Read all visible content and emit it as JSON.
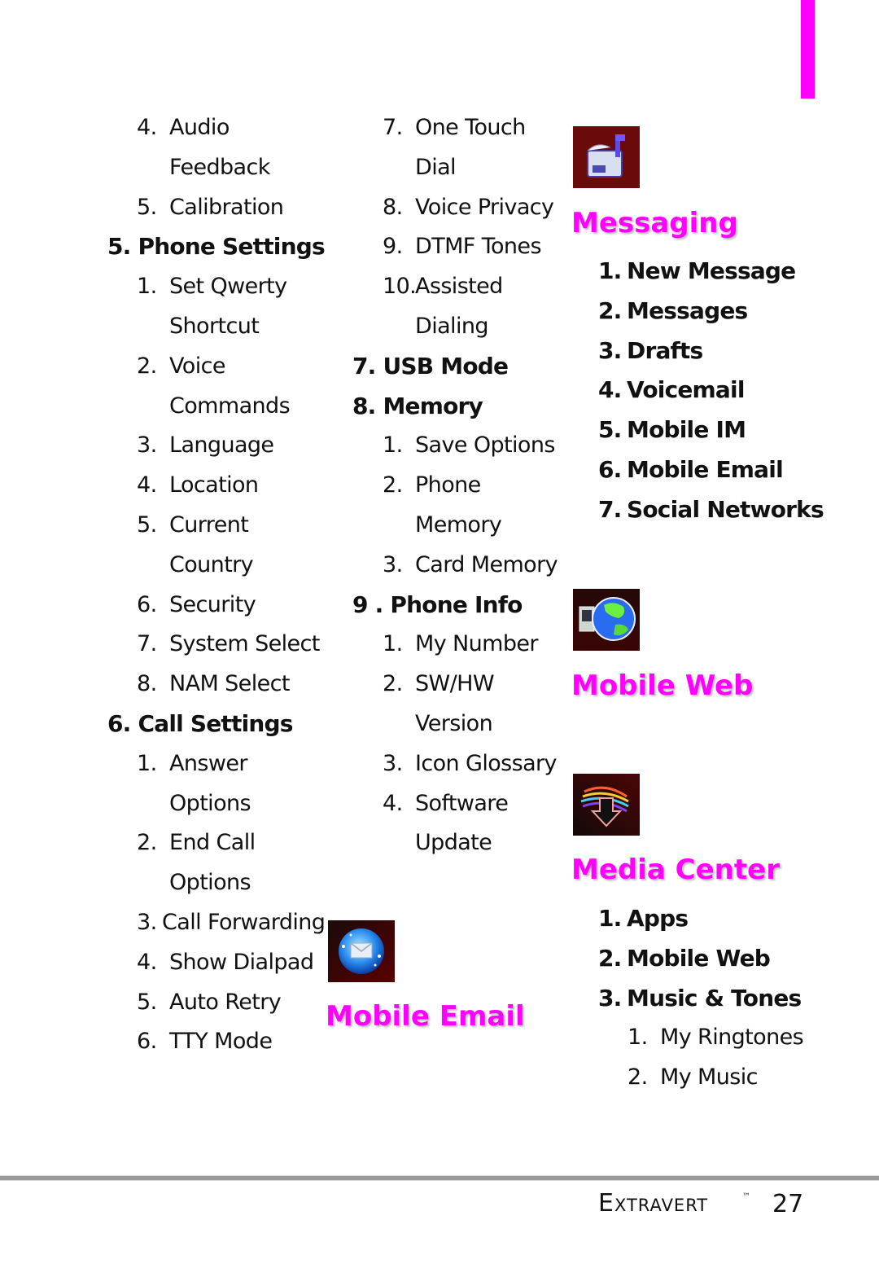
{
  "page": {
    "brand": "Extravert",
    "trademark": "™",
    "page_number": "27",
    "accent_color": "#ff00ff"
  },
  "col1": [
    {
      "type": "sub",
      "num": "4.",
      "text": "Audio"
    },
    {
      "type": "cont",
      "text": "Feedback"
    },
    {
      "type": "sub",
      "num": "5.",
      "text": "Calibration"
    },
    {
      "type": "head",
      "num": "5.",
      "text": "Phone Settings"
    },
    {
      "type": "sub",
      "num": "1.",
      "text": "Set Qwerty"
    },
    {
      "type": "cont",
      "text": "Shortcut"
    },
    {
      "type": "sub",
      "num": "2.",
      "text": "Voice"
    },
    {
      "type": "cont",
      "text": "Commands"
    },
    {
      "type": "sub",
      "num": "3.",
      "text": "Language"
    },
    {
      "type": "sub",
      "num": "4.",
      "text": "Location"
    },
    {
      "type": "sub",
      "num": "5.",
      "text": "Current"
    },
    {
      "type": "cont",
      "text": "Country"
    },
    {
      "type": "sub",
      "num": "6.",
      "text": "Security"
    },
    {
      "type": "sub",
      "num": "7.",
      "text": "System Select"
    },
    {
      "type": "sub",
      "num": "8.",
      "text": "NAM Select"
    },
    {
      "type": "head",
      "num": "6.",
      "text": "Call Settings"
    },
    {
      "type": "sub",
      "num": "1.",
      "text": "Answer"
    },
    {
      "type": "cont",
      "text": "Options"
    },
    {
      "type": "sub",
      "num": "2.",
      "text": "End Call"
    },
    {
      "type": "cont",
      "text": "Options"
    },
    {
      "type": "subtight",
      "num": "3.",
      "text": "Call Forwarding"
    },
    {
      "type": "sub",
      "num": "4.",
      "text": "Show Dialpad"
    },
    {
      "type": "sub",
      "num": "5.",
      "text": "Auto Retry"
    },
    {
      "type": "sub",
      "num": "6.",
      "text": "TTY Mode"
    }
  ],
  "col2": [
    {
      "type": "sub",
      "num": "7.",
      "text": "One Touch"
    },
    {
      "type": "cont",
      "text": "Dial"
    },
    {
      "type": "sub",
      "num": "8.",
      "text": "Voice Privacy"
    },
    {
      "type": "sub",
      "num": "9.",
      "text": "DTMF Tones"
    },
    {
      "type": "subtight",
      "num": "10.",
      "text": "Assisted"
    },
    {
      "type": "cont",
      "text": "Dialing"
    },
    {
      "type": "head",
      "num": "7.",
      "text": "USB Mode"
    },
    {
      "type": "head",
      "num": "8.",
      "text": "Memory"
    },
    {
      "type": "sub",
      "num": "1.",
      "text": "Save Options"
    },
    {
      "type": "sub",
      "num": "2.",
      "text": "Phone"
    },
    {
      "type": "cont",
      "text": "Memory"
    },
    {
      "type": "sub",
      "num": "3.",
      "text": "Card Memory"
    },
    {
      "type": "head",
      "num": "9 .",
      "text": "Phone Info"
    },
    {
      "type": "sub",
      "num": "1.",
      "text": "My Number"
    },
    {
      "type": "sub",
      "num": "2.",
      "text": "SW/HW"
    },
    {
      "type": "cont",
      "text": "Version"
    },
    {
      "type": "sub",
      "num": "3.",
      "text": "Icon Glossary"
    },
    {
      "type": "sub",
      "num": "4.",
      "text": "Software"
    },
    {
      "type": "cont",
      "text": "Update"
    }
  ],
  "sections": {
    "mobile_email": {
      "title": "Mobile Email",
      "icon": "mobile-email-icon"
    },
    "messaging": {
      "title": "Messaging",
      "icon": "messaging-mailbox-icon",
      "items": [
        {
          "num": "1.",
          "text": "New Message"
        },
        {
          "num": "2.",
          "text": "Messages"
        },
        {
          "num": "3.",
          "text": "Drafts"
        },
        {
          "num": "4.",
          "text": "Voicemail"
        },
        {
          "num": "5.",
          "text": "Mobile IM"
        },
        {
          "num": "6.",
          "text": "Mobile Email"
        },
        {
          "num": "7.",
          "text": "Social Networks"
        }
      ]
    },
    "mobile_web": {
      "title": "Mobile Web",
      "icon": "globe-icon"
    },
    "media_center": {
      "title": "Media Center",
      "icon": "download-arrow-icon",
      "items": [
        {
          "num": "1.",
          "text": "Apps",
          "level": "main"
        },
        {
          "num": "2.",
          "text": "Mobile Web",
          "level": "main"
        },
        {
          "num": "3.",
          "text": "Music & Tones",
          "level": "main"
        },
        {
          "num": "1.",
          "text": "My Ringtones",
          "level": "sub"
        },
        {
          "num": "2.",
          "text": "My Music",
          "level": "sub"
        }
      ]
    }
  }
}
